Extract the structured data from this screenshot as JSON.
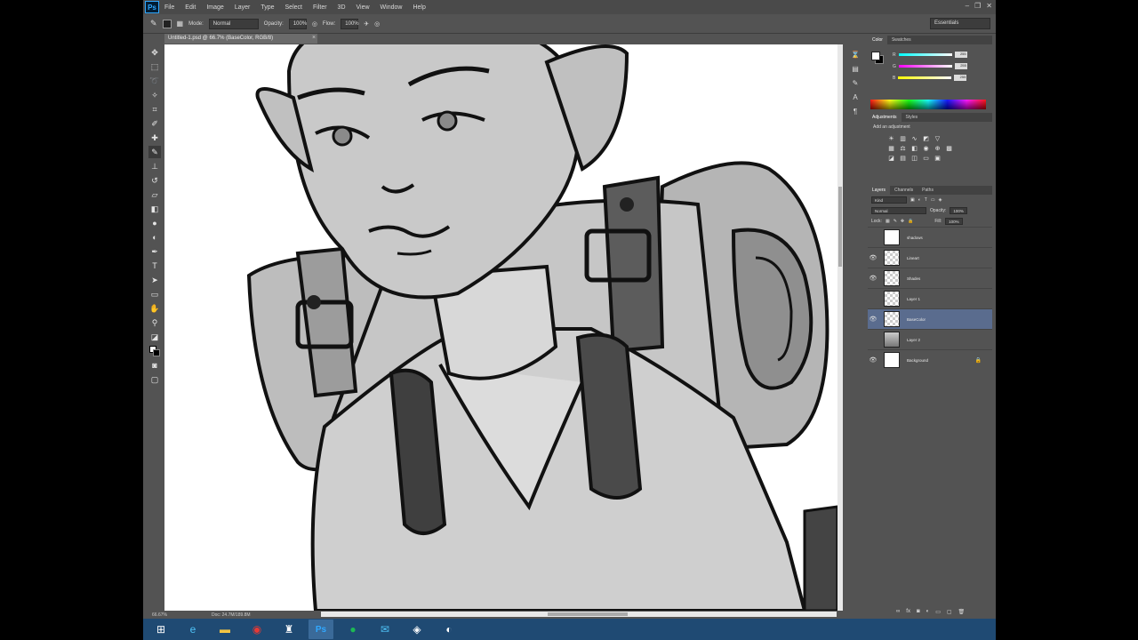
{
  "app": {
    "logo": "Ps"
  },
  "menu": [
    "File",
    "Edit",
    "Image",
    "Layer",
    "Type",
    "Select",
    "Filter",
    "3D",
    "View",
    "Window",
    "Help"
  ],
  "options": {
    "mode_label": "Mode:",
    "mode_value": "Normal",
    "opacity_label": "Opacity:",
    "opacity_value": "100%",
    "flow_label": "Flow:",
    "flow_value": "100%",
    "workspace": "Essentials"
  },
  "document": {
    "tab_title": "Untitled-1.psd @ 66.7% (BaseColor, RGB/8)",
    "close": "×"
  },
  "status": {
    "zoom": "66.67%",
    "doc_info": "Doc: 24.7M/189.8M"
  },
  "color_panel": {
    "tabs": [
      "Color",
      "Swatches"
    ],
    "channels": [
      {
        "label": "R",
        "value": "255"
      },
      {
        "label": "G",
        "value": "255"
      },
      {
        "label": "B",
        "value": "255"
      }
    ]
  },
  "adjustments_panel": {
    "tabs": [
      "Adjustments",
      "Styles"
    ],
    "title": "Add an adjustment"
  },
  "layers_panel": {
    "tabs": [
      "Layers",
      "Channels",
      "Paths"
    ],
    "kind_label": "Kind",
    "blend_mode": "Normal",
    "opacity_label": "Opacity:",
    "opacity_value": "100%",
    "lock_label": "Lock:",
    "fill_label": "Fill:",
    "fill_value": "100%",
    "layers": [
      {
        "name": "shadows",
        "visible": false,
        "thumb": "plain",
        "selected": false
      },
      {
        "name": "Lineart",
        "visible": true,
        "thumb": "checker",
        "selected": false
      },
      {
        "name": "Shades",
        "visible": true,
        "thumb": "checker",
        "selected": false
      },
      {
        "name": "Layer 1",
        "visible": false,
        "thumb": "checker",
        "selected": false
      },
      {
        "name": "BaseColor",
        "visible": true,
        "thumb": "checker",
        "selected": true
      },
      {
        "name": "Layer 2",
        "visible": false,
        "thumb": "gray",
        "selected": false
      },
      {
        "name": "Background",
        "visible": true,
        "thumb": "plain",
        "selected": false,
        "locked": true
      }
    ]
  },
  "taskbar": {
    "items": [
      "start",
      "internet-explorer",
      "file-explorer",
      "chrome",
      "other-app",
      "photoshop",
      "spotify",
      "mail",
      "media",
      "misc"
    ]
  }
}
